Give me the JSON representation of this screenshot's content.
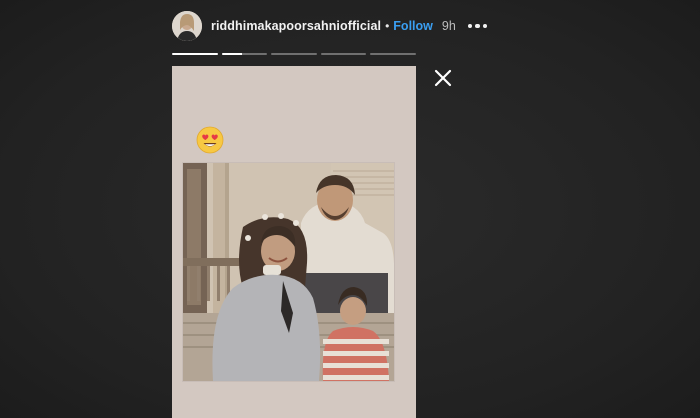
{
  "story_header": {
    "username": "riddhimakapoorsahniofficial",
    "separator": "•",
    "follow_label": "Follow",
    "timestamp": "9h"
  },
  "progress": {
    "segments": 5,
    "current_index": 1,
    "current_fraction": 0.45
  },
  "story": {
    "background_color": "#d3c8c1",
    "sticker": "heart-eyes-emoji",
    "photo": "vintage family photograph"
  },
  "icons": {
    "close": "close-icon",
    "more": "more-options-icon"
  },
  "colors": {
    "background": "#262626",
    "follow": "#3a9ff2",
    "text": "#f2f2f2"
  }
}
